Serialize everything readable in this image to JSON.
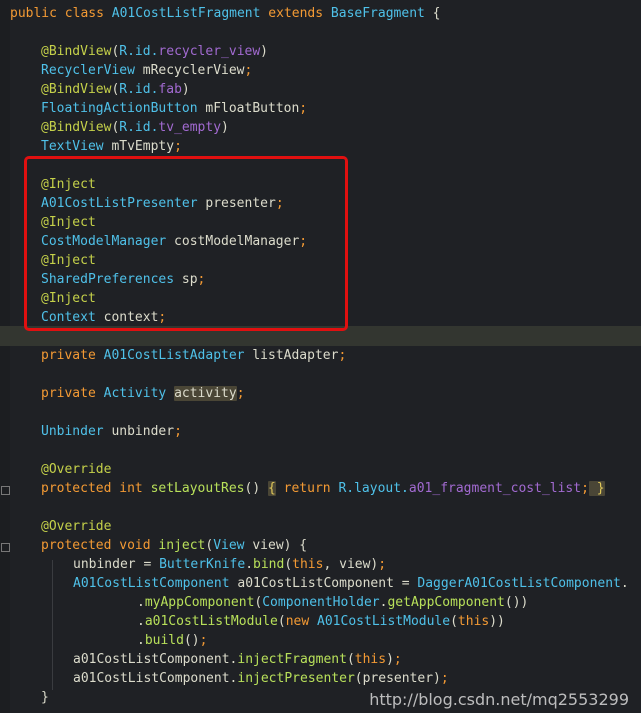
{
  "code": {
    "l1": {
      "a": "public class ",
      "b": "A01CostListFragment",
      "c": " extends ",
      "d": "BaseFragment",
      "e": " {"
    },
    "l2": {
      "a": "@BindView",
      "b": "(",
      "c": "R.id.",
      "d": "recycler_view",
      "e": ")"
    },
    "l3": {
      "a": "RecyclerView",
      "b": " mRecyclerView",
      "c": ";"
    },
    "l4": {
      "a": "@BindView",
      "b": "(",
      "c": "R.id.",
      "d": "fab",
      "e": ")"
    },
    "l5": {
      "a": "FloatingActionButton",
      "b": " mFloatButton",
      "c": ";"
    },
    "l6": {
      "a": "@BindView",
      "b": "(",
      "c": "R.id.",
      "d": "tv_empty",
      "e": ")"
    },
    "l7": {
      "a": "TextView",
      "b": " mTvEmpty",
      "c": ";"
    },
    "l8": {
      "a": "@Inject"
    },
    "l9": {
      "a": "A01CostListPresenter",
      "b": " presenter",
      "c": ";"
    },
    "l10": {
      "a": "@Inject"
    },
    "l11": {
      "a": "CostModelManager",
      "b": " costModelManager",
      "c": ";"
    },
    "l12": {
      "a": "@Inject"
    },
    "l13": {
      "a": "SharedPreferences",
      "b": " sp",
      "c": ";"
    },
    "l14": {
      "a": "@Inject"
    },
    "l15": {
      "a": "Context",
      "b": " context",
      "c": ";"
    },
    "l16": {
      "a": "private ",
      "b": "A01CostListAdapter",
      "c": " listAdapter",
      "d": ";"
    },
    "l17": {
      "a": "private ",
      "b": "Activity ",
      "c": "activity",
      "d": ";"
    },
    "l18": {
      "a": "Unbinder",
      "b": " unbinder",
      "c": ";"
    },
    "l19": {
      "a": "@Override"
    },
    "l20": {
      "a": "protected int ",
      "b": "setLayoutRes",
      "c": "() ",
      "d": "{",
      "e": " return ",
      "f": "R.layout.",
      "g": "a01_fragment_cost_list",
      "h": ";",
      "i": " }"
    },
    "l21": {
      "a": "@Override"
    },
    "l22": {
      "a": "protected void ",
      "b": "inject",
      "c": "(",
      "d": "View",
      "e": " view) {"
    },
    "l23": {
      "a": "unbinder = ",
      "b": "ButterKnife",
      "c": ".",
      "d": "bind",
      "e": "(",
      "f": "this",
      "g": ", view)",
      "h": ";"
    },
    "l24": {
      "a": "A01CostListComponent",
      "b": " a01CostListComponent = ",
      "c": "DaggerA01CostListComponent",
      "d": "."
    },
    "l25": {
      "a": ".",
      "b": "myAppComponent",
      "c": "(",
      "d": "ComponentHolder",
      "e": ".",
      "f": "getAppComponent",
      "g": "())"
    },
    "l26": {
      "a": ".",
      "b": "a01CostListModule",
      "c": "(",
      "d": "new ",
      "e": "A01CostListModule",
      "f": "(",
      "g": "this",
      "h": "))"
    },
    "l27": {
      "a": ".",
      "b": "build",
      "c": "()",
      "d": ";"
    },
    "l28": {
      "a": "a01CostListComponent.",
      "b": "injectFragment",
      "c": "(",
      "d": "this",
      "e": ")",
      "f": ";"
    },
    "l29": {
      "a": "a01CostListComponent.",
      "b": "injectPresenter",
      "c": "(presenter)",
      "d": ";"
    },
    "l30": {
      "a": "}"
    }
  },
  "watermark": "http://blog.csdn.net/mq2553299",
  "colors": {
    "keyword": "#f39a34",
    "type": "#4fc1e9",
    "annotation": "#c5d14a",
    "method": "#b8e05a",
    "resource": "#a26ad1",
    "highlight_box": "#e01010"
  }
}
